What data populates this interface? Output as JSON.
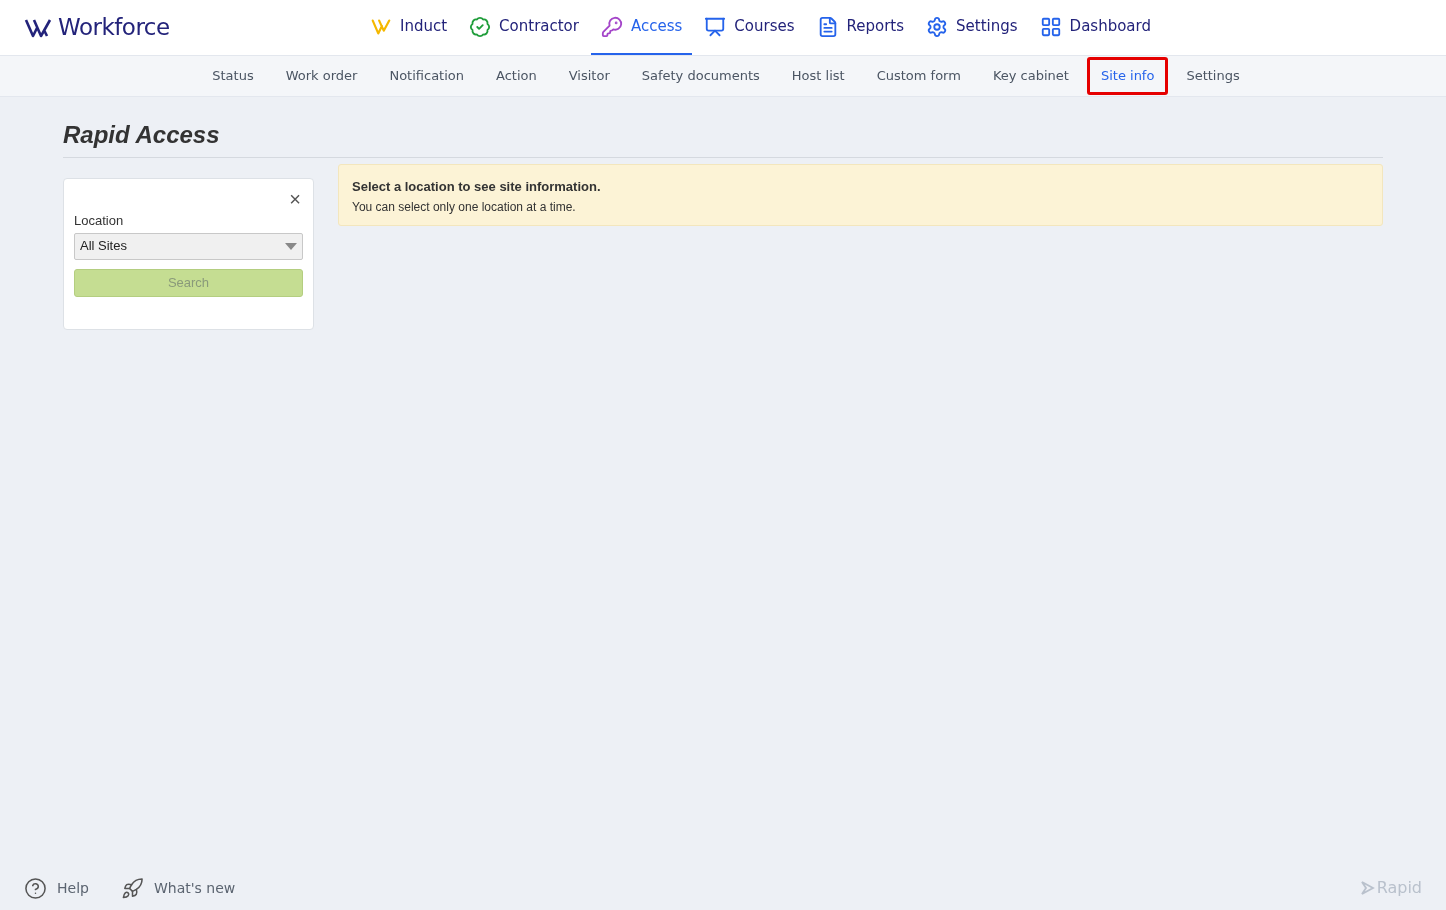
{
  "brand": {
    "name": "Workforce"
  },
  "main_nav": [
    {
      "label": "Induct",
      "selected": false
    },
    {
      "label": "Contractor",
      "selected": false
    },
    {
      "label": "Access",
      "selected": true
    },
    {
      "label": "Courses",
      "selected": false
    },
    {
      "label": "Reports",
      "selected": false
    },
    {
      "label": "Settings",
      "selected": false
    },
    {
      "label": "Dashboard",
      "selected": false
    }
  ],
  "sub_nav": [
    {
      "label": "Status",
      "selected": false,
      "highlighted": false
    },
    {
      "label": "Work order",
      "selected": false,
      "highlighted": false
    },
    {
      "label": "Notification",
      "selected": false,
      "highlighted": false
    },
    {
      "label": "Action",
      "selected": false,
      "highlighted": false
    },
    {
      "label": "Visitor",
      "selected": false,
      "highlighted": false
    },
    {
      "label": "Safety documents",
      "selected": false,
      "highlighted": false
    },
    {
      "label": "Host list",
      "selected": false,
      "highlighted": false
    },
    {
      "label": "Custom form",
      "selected": false,
      "highlighted": false
    },
    {
      "label": "Key cabinet",
      "selected": false,
      "highlighted": false
    },
    {
      "label": "Site info",
      "selected": true,
      "highlighted": true
    },
    {
      "label": "Settings",
      "selected": false,
      "highlighted": false
    }
  ],
  "page_title": "Rapid Access",
  "filter_panel": {
    "close": "×",
    "location_label": "Location",
    "location_value": "All Sites",
    "search_button": "Search",
    "search_disabled": true
  },
  "notice": {
    "title": "Select a location to see site information.",
    "text": "You can select only one location at a time."
  },
  "footer": {
    "links": [
      "Help",
      "What's new"
    ],
    "logo": "Rapid"
  }
}
